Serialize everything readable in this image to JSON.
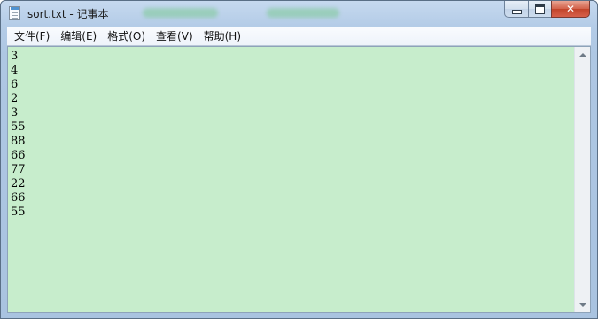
{
  "window": {
    "title": "sort.txt - 记事本"
  },
  "controls": {
    "close_glyph": "✕"
  },
  "menu": {
    "items": [
      {
        "label": "文件(F)"
      },
      {
        "label": "编辑(E)"
      },
      {
        "label": "格式(O)"
      },
      {
        "label": "查看(V)"
      },
      {
        "label": "帮助(H)"
      }
    ]
  },
  "editor": {
    "content": "3\n4\n6\n2\n3\n55\n88\n66\n77\n22\n66\n55"
  },
  "colors": {
    "editor_background": "#c7edcc",
    "close_button": "#c2442a"
  },
  "icons": {
    "app": "notepad-icon",
    "minimize": "minimize-icon",
    "maximize": "maximize-icon",
    "close": "close-icon",
    "scroll_up": "chevron-up-icon",
    "scroll_down": "chevron-down-icon"
  }
}
